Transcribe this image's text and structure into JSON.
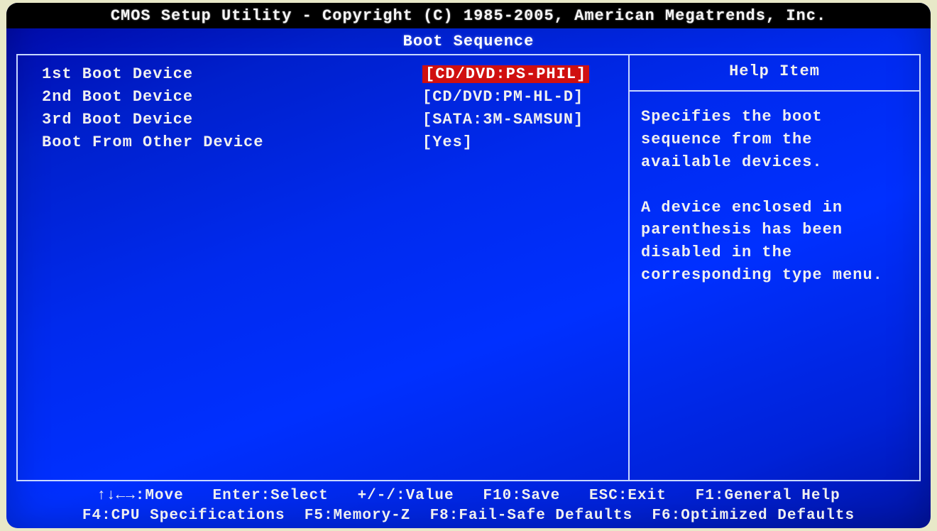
{
  "header": {
    "title": "CMOS Setup Utility - Copyright (C) 1985-2005, American Megatrends, Inc.",
    "subtitle": "Boot Sequence"
  },
  "boot_items": [
    {
      "label": "1st Boot Device",
      "value": "[CD/DVD:PS-PHIL]",
      "selected": true
    },
    {
      "label": "2nd Boot Device",
      "value": "[CD/DVD:PM-HL-D]",
      "selected": false
    },
    {
      "label": "3rd Boot Device",
      "value": "[SATA:3M-SAMSUN]",
      "selected": false
    },
    {
      "label": "Boot From Other Device",
      "value": "[Yes]",
      "selected": false
    }
  ],
  "help": {
    "title": "Help Item",
    "body": "Specifies the boot sequence from the available devices.\n\nA device enclosed in parenthesis has been disabled in the corresponding type menu."
  },
  "footer": {
    "line1": "↑↓←→:Move   Enter:Select   +/-/:Value   F10:Save   ESC:Exit   F1:General Help",
    "line2": "F4:CPU Specifications  F5:Memory-Z  F8:Fail-Safe Defaults  F6:Optimized Defaults"
  }
}
